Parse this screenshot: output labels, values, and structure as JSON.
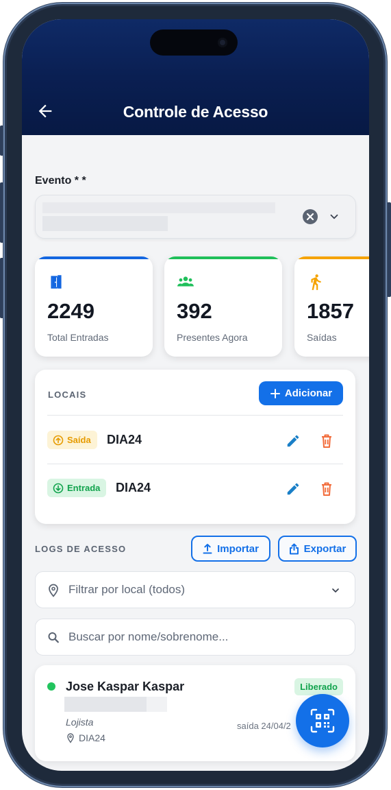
{
  "colors": {
    "header": "#0a1f52",
    "primary": "#1370e8",
    "blue_bar": "#1366e0",
    "green_bar": "#1fbf5a",
    "orange_bar": "#f5a300",
    "danger": "#f26b3a"
  },
  "header": {
    "title": "Controle de Acesso",
    "back_icon": "arrow-left-icon"
  },
  "evento": {
    "label": "Evento * *"
  },
  "stats": [
    {
      "value": "2249",
      "label": "Total Entradas",
      "icon": "door-icon"
    },
    {
      "value": "392",
      "label": "Presentes Agora",
      "icon": "group-icon"
    },
    {
      "value": "1857",
      "label": "Saídas",
      "icon": "walking-icon"
    }
  ],
  "locais": {
    "title": "LOCAIS",
    "add_label": "Adicionar",
    "items": [
      {
        "type": "Saída",
        "name": "DIA24"
      },
      {
        "type": "Entrada",
        "name": "DIA24"
      }
    ]
  },
  "logs": {
    "title": "LOGS DE ACESSO",
    "import_label": "Importar",
    "export_label": "Exportar",
    "filter_placeholder": "Filtrar por local (todos)",
    "search_placeholder": "Buscar por nome/sobrenome...",
    "entries": [
      {
        "name": "Jose Kaspar Kaspar",
        "status": "Liberado",
        "role": "Lojista",
        "location": "DIA24",
        "time": "saída 24/04/2"
      }
    ]
  }
}
